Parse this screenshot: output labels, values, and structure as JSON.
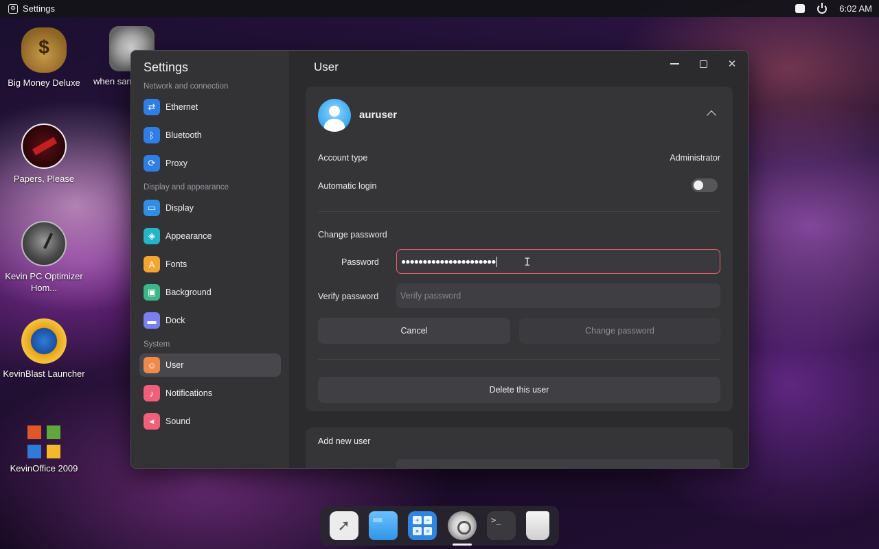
{
  "topbar": {
    "app_name": "Settings",
    "time": "6:02 AM"
  },
  "desktop": {
    "icons": [
      {
        "label": "Big Money Deluxe"
      },
      {
        "label": "when same russian"
      },
      {
        "label": "Papers, Please"
      },
      {
        "label": "Kevin PC Optimizer Hom..."
      },
      {
        "label": "KevinBlast Launcher"
      },
      {
        "label": "KevinOffice 2009"
      }
    ]
  },
  "sidebar": {
    "title": "Settings",
    "sections": [
      {
        "label": "Network and connection",
        "items": [
          {
            "label": "Ethernet",
            "color": "#2f7ee6"
          },
          {
            "label": "Bluetooth",
            "color": "#2f7ee6"
          },
          {
            "label": "Proxy",
            "color": "#2f7ee6"
          }
        ]
      },
      {
        "label": "Display and appearance",
        "items": [
          {
            "label": "Display",
            "color": "#2f8ee6"
          },
          {
            "label": "Appearance",
            "color": "#25b5c9"
          },
          {
            "label": "Fonts",
            "color": "#f2a530"
          },
          {
            "label": "Background",
            "color": "#3bb58a"
          },
          {
            "label": "Dock",
            "color": "#7a7ef0"
          }
        ]
      },
      {
        "label": "System",
        "items": [
          {
            "label": "User",
            "color": "#f08a4a"
          },
          {
            "label": "Notifications",
            "color": "#f0607a"
          },
          {
            "label": "Sound",
            "color": "#f0607a"
          }
        ]
      }
    ]
  },
  "main": {
    "title": "User",
    "user": {
      "name": "auruser",
      "account_type_label": "Account type",
      "account_type_value": "Administrator",
      "auto_login_label": "Automatic login",
      "auto_login_on": false
    },
    "change_password": {
      "heading": "Change password",
      "password_label": "Password",
      "password_value": "●●●●●●●●●●●●●●●●●●●●●●",
      "verify_label": "Verify password",
      "verify_placeholder": "Verify password",
      "cancel_label": "Cancel",
      "submit_label": "Change password"
    },
    "delete_label": "Delete this user",
    "add_user_label": "Add new user"
  },
  "colors": {
    "accent_error": "#e0626b",
    "window_bg": "#2b2b2e",
    "sidebar_bg": "#333336"
  }
}
